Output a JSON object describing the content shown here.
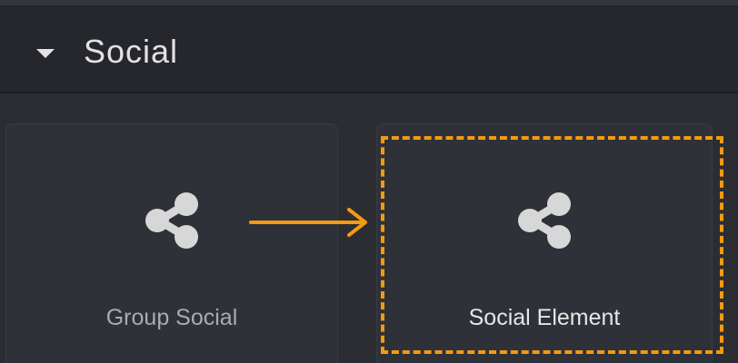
{
  "section": {
    "title": "Social",
    "caret_icon": "caret-down-icon"
  },
  "tiles": [
    {
      "label": "Group Social",
      "icon": "share-icon"
    },
    {
      "label": "Social Element",
      "icon": "share-icon"
    }
  ],
  "annotations": {
    "highlight_color": "#f39a12",
    "arrow_color": "#f39a12"
  }
}
